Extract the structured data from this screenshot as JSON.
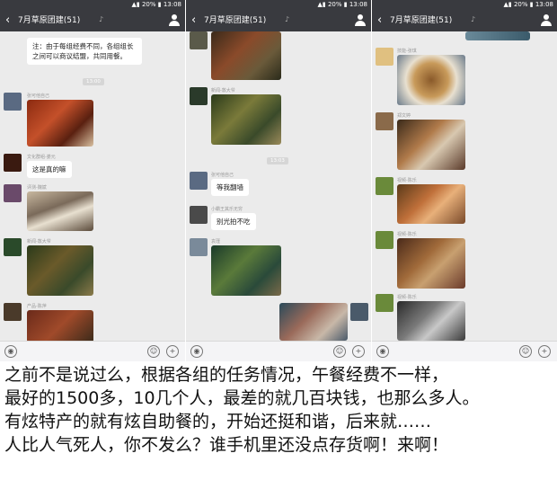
{
  "chat_title": "7月草原团建(51)",
  "status_bar": {
    "signal": "20%",
    "time": "13:08"
  },
  "panel1": {
    "note": "注：由于每组经费不同，各组组长之间可以商议结盟，共同用餐。",
    "time_label": "13:00",
    "names": [
      "张可他自己",
      "文化群组-娄元",
      "评测-魏斌",
      "新闻-敦大爷",
      "产品-陈萍"
    ],
    "messages": [
      "这是真的嘛"
    ]
  },
  "panel2": {
    "time_label": "13:03",
    "names": [
      "新闻-敦大爷",
      "张可他自己",
      "小霸王其乐无穷",
      "袁瑾"
    ],
    "messages": [
      "等我翻墙",
      "别光拍不吃"
    ]
  },
  "panel3": {
    "names": [
      "技能-张琪",
      "郑文婷",
      "视频-陈乐",
      "视频-陈乐",
      "视频-陈乐"
    ]
  },
  "caption": {
    "line1": "之前不是说过么，根据各组的任务情况，午餐经费不一样，",
    "line2": "最好的1500多，10几个人，最差的就几百块钱，也那么多人。",
    "line3": "有炫特产的就有炫自助餐的，开始还挺和谐，后来就……",
    "line4": "人比人气死人，你不发么？谁手机里还没点存货啊！来啊！"
  }
}
